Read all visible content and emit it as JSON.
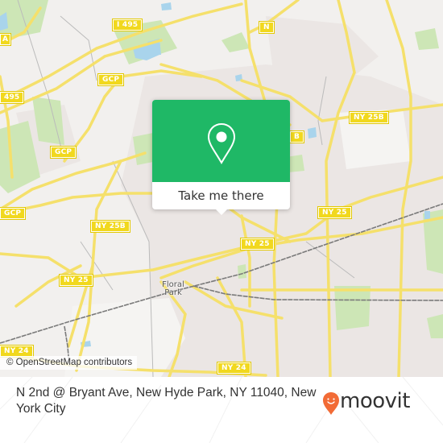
{
  "map": {
    "road_shields": [
      {
        "label": "I 495",
        "id": "i495-top"
      },
      {
        "label": "N",
        "id": "n"
      },
      {
        "label": "495",
        "id": "i495-left"
      },
      {
        "label": "GCP",
        "id": "gcp-top"
      },
      {
        "label": "GCP",
        "id": "gcp-mid"
      },
      {
        "label": "GCP",
        "id": "gcp-left"
      },
      {
        "label": "NY 25B",
        "id": "ny25b-right"
      },
      {
        "label": "B",
        "id": "ny25b-partial"
      },
      {
        "label": "NY 25B",
        "id": "ny25b-left"
      },
      {
        "label": "NY 25",
        "id": "ny25-right"
      },
      {
        "label": "NY 25",
        "id": "ny25-center"
      },
      {
        "label": "NY 25",
        "id": "ny25-left"
      },
      {
        "label": "NY 24",
        "id": "ny24-left"
      },
      {
        "label": "NY 24",
        "id": "ny24-bottom"
      },
      {
        "label": "A",
        "id": "a-edge"
      }
    ],
    "place_labels": [
      {
        "label": "Floral Park"
      }
    ],
    "colors": {
      "road": "#f5e06b",
      "land": "#f2f0ee",
      "residential": "#ece7e5",
      "park": "#c9e3b1",
      "water": "#a9d4ec",
      "rail": "#777777"
    }
  },
  "popup": {
    "icon": "map-pin-icon",
    "button_label": "Take me there",
    "accent_color": "#1fb866"
  },
  "attribution": "© OpenStreetMap contributors",
  "footer": {
    "address": "N 2nd @ Bryant Ave, New Hyde Park, NY 11040, New York City",
    "brand": {
      "name": "moovit",
      "icon": "moovit-smiley-pin-icon",
      "color": "#f26b36"
    }
  }
}
